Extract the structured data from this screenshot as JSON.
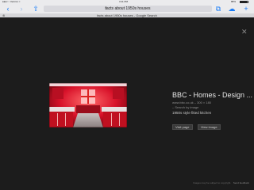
{
  "status_bar": {
    "carrier": "●●●○○ Verizon ≈",
    "time": "3:11 PM",
    "battery": "88%"
  },
  "toolbar": {
    "back_icon": "‹",
    "forward_icon": "›",
    "share_icon": "⇧",
    "search_icon": "⌕",
    "url_text": "facts about 1950s houses",
    "reader_icon": "⧉",
    "cloud_icon": "☁",
    "new_tab_icon": "+",
    "accent": "#1a7cf6"
  },
  "tab": {
    "close_icon": "⊗",
    "title": "facts about 1950s houses - Google Search"
  },
  "viewer": {
    "close_icon": "✕",
    "title": "BBC - Homes - Design ...",
    "source": "www.bbc.co.uk – 300 × 180",
    "search_by_image": "– Search by image",
    "caption": "1950s style fitted kitchen",
    "visit_page": "Visit page",
    "view_image": "View image",
    "footer_text": "Images may be subject to copyright.",
    "footer_link": "Send feedback"
  }
}
